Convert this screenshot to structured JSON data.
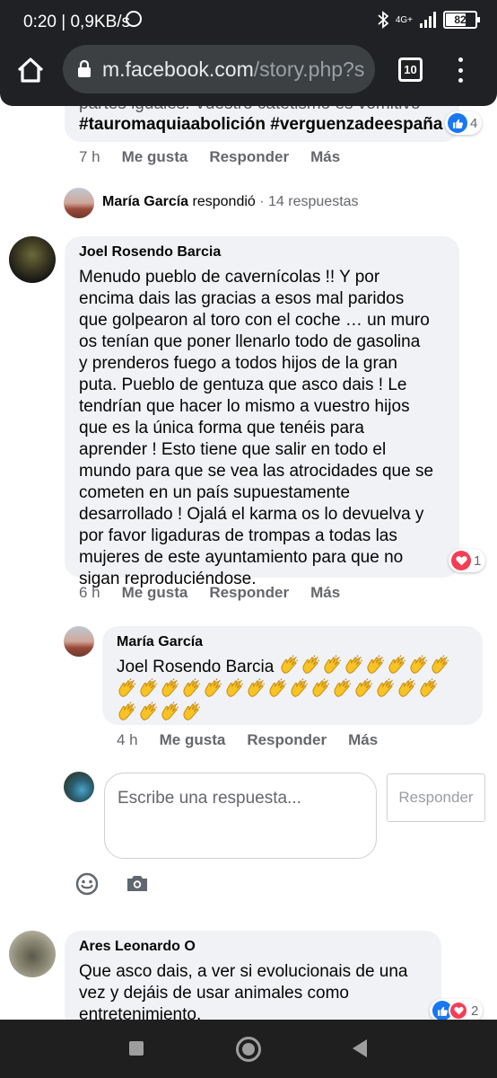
{
  "status": {
    "time": "0:20",
    "speed": "0,9KB/s",
    "network": "4G+",
    "battery": "82"
  },
  "browser": {
    "url_host": "m.facebook.com",
    "url_path": "/story.php?s",
    "tab_count": "10"
  },
  "comments": [
    {
      "text_line1": "partes iguales. Vuestro catetismo es vomitivo",
      "text_line2": "#tauromaquiaabolición #verguenzadeespaña",
      "reactions": "4",
      "time": "7 h",
      "like": "Me gusta",
      "reply": "Responder",
      "more": "Más"
    },
    {
      "author": "Joel Rosendo Barcia",
      "lines": [
        "Menudo pueblo de cavernícolas !! Y por",
        "encima dais las gracias a esos mal paridos",
        "que golpearon al toro con el coche … un muro",
        "os tenían que poner llenarlo todo de gasolina",
        "y prenderos fuego a todos hijos de la gran",
        "puta. Pueblo de gentuza que asco dais ! Le",
        "tendrían que hacer lo mismo a vuestro hijos",
        "que es la única forma que tenéis para",
        "aprender ! Esto tiene que salir en todo el",
        "mundo para que se vea las atrocidades que se",
        "cometen en un país supuestamente",
        "desarrollado ! Ojalá el karma os lo devuelva y",
        "por favor ligaduras de trompas a todas las",
        "mujeres de este ayuntamiento para que no",
        "sigan reproduciéndose."
      ],
      "reactions": "1",
      "time": "6 h",
      "like": "Me gusta",
      "reply": "Responder",
      "more": "Más"
    },
    {
      "author": "Ares Leonardo O",
      "lines": [
        "Que asco dais, a ver si evolucionais de una",
        "vez y dejáis de usar animales como",
        "entretenimiento."
      ],
      "reactions": "2"
    }
  ],
  "replies_summary": {
    "author": "María García",
    "verb": "respondió",
    "count": "· 14 respuestas"
  },
  "reply": {
    "author": "María García",
    "mention": "Joel Rosendo Barcia",
    "claps_line1": 8,
    "claps_line2": 15,
    "claps_line3": 4,
    "time": "4 h",
    "like": "Me gusta",
    "reply": "Responder",
    "more": "Más"
  },
  "composer": {
    "placeholder": "Escribe una respuesta...",
    "button": "Responder"
  },
  "colors": {
    "like_blue": "#1877f2",
    "love_red": "#f33e58"
  }
}
